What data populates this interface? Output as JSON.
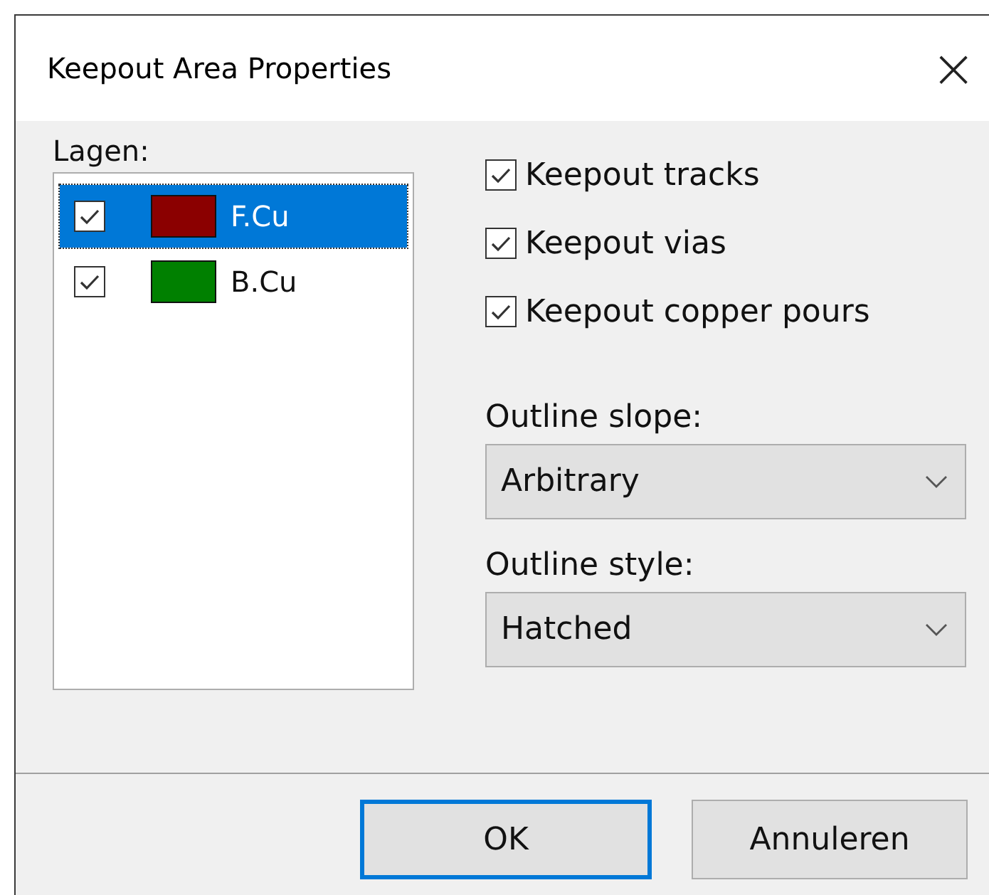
{
  "window": {
    "title": "Keepout Area Properties",
    "close": "×"
  },
  "layers": {
    "label": "Lagen:",
    "items": [
      {
        "name": "F.Cu",
        "color": "#8b0000",
        "checked": true,
        "selected": true
      },
      {
        "name": "B.Cu",
        "color": "#008000",
        "checked": true,
        "selected": false
      }
    ]
  },
  "options": [
    {
      "label": "Keepout tracks",
      "checked": true
    },
    {
      "label": "Keepout vias",
      "checked": true
    },
    {
      "label": "Keepout copper pours",
      "checked": true
    }
  ],
  "dropdowns": [
    {
      "label": "Outline slope:",
      "value": "Arbitrary"
    },
    {
      "label": "Outline style:",
      "value": "Hatched"
    }
  ],
  "buttons": [
    {
      "label": "OK",
      "default": true
    },
    {
      "label": "Annuleren",
      "default": false
    }
  ]
}
